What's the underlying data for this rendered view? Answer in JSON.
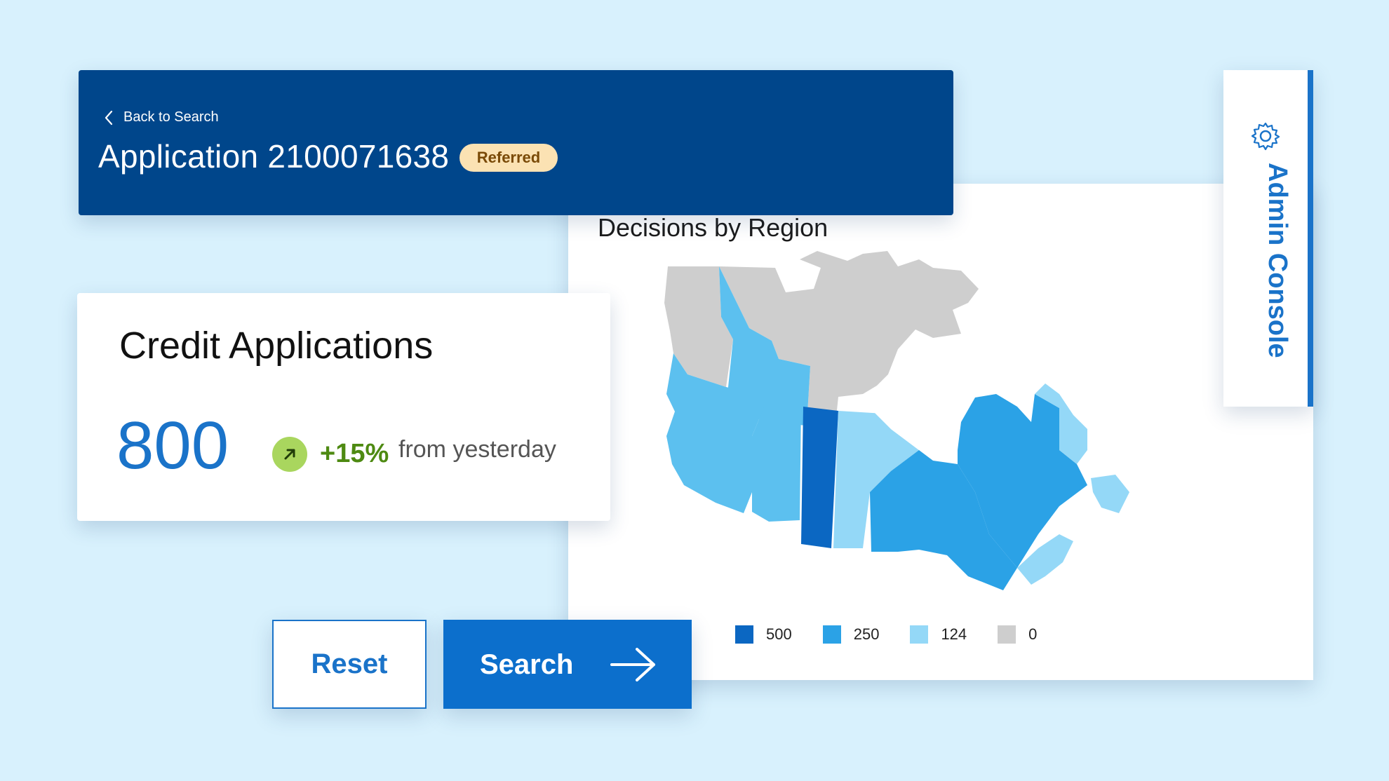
{
  "header": {
    "back_label": "Back to Search",
    "title": "Application 2100071638",
    "status": "Referred"
  },
  "credit_card": {
    "title": "Credit Applications",
    "value": "800",
    "trend_percent": "+15%",
    "trend_label": "from yesterday"
  },
  "map_panel": {
    "title": "Decisions by Region",
    "legend": [
      {
        "label": "500",
        "color": "#0b67c2"
      },
      {
        "label": "250",
        "color": "#2ba2e6"
      },
      {
        "label": "124",
        "color": "#94d8f7"
      },
      {
        "label": "0",
        "color": "#cecece"
      }
    ]
  },
  "admin": {
    "label": "Admin Console",
    "icon": "gear-icon"
  },
  "buttons": {
    "reset": "Reset",
    "search": "Search"
  },
  "colors": {
    "header_bg": "#00468b",
    "accent": "#1a73c9",
    "badge_bg": "#fbe2b3",
    "trend_green": "#4e8a12",
    "page_bg": "#d8f1fd"
  }
}
